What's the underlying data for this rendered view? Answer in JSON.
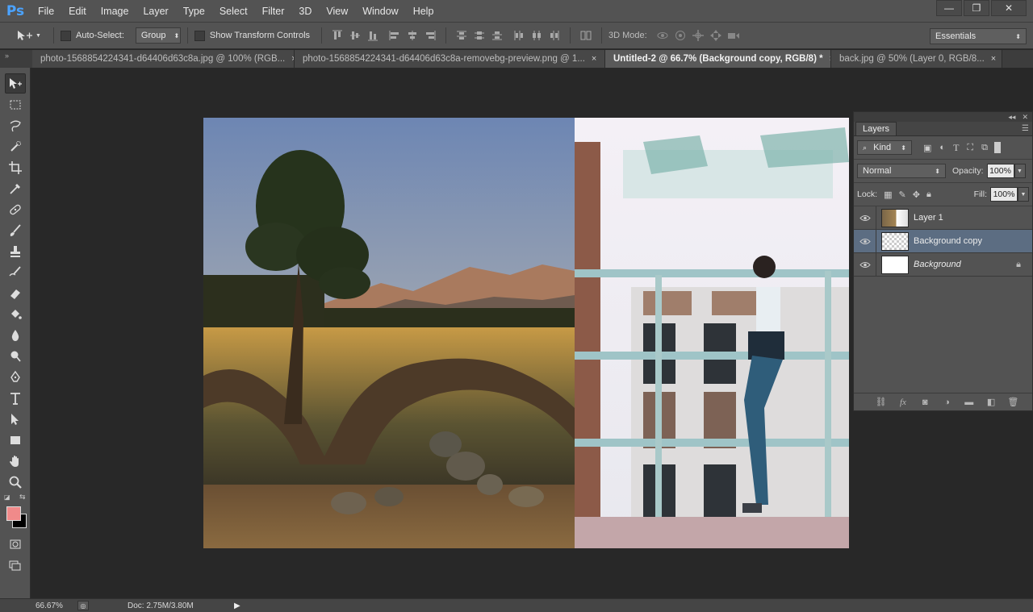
{
  "app": {
    "logo": "Ps"
  },
  "menu": [
    "File",
    "Edit",
    "Image",
    "Layer",
    "Type",
    "Select",
    "Filter",
    "3D",
    "View",
    "Window",
    "Help"
  ],
  "window_controls": {
    "minimize": "—",
    "restore": "❐",
    "close": "✕"
  },
  "options": {
    "auto_select_label": "Auto-Select:",
    "auto_select_value": "Group",
    "show_transform_label": "Show Transform Controls",
    "mode_3d_label": "3D Mode:",
    "workspace_value": "Essentials"
  },
  "tabs": [
    {
      "label": "photo-1568854224341-d64406d63c8a.jpg @ 100% (RGB...",
      "active": false
    },
    {
      "label": "photo-1568854224341-d64406d63c8a-removebg-preview.png @ 1...",
      "active": false
    },
    {
      "label": "Untitled-2 @ 66.7% (Background copy, RGB/8) *",
      "active": true
    },
    {
      "label": "back.jpg @ 50% (Layer 0, RGB/8...",
      "active": false
    }
  ],
  "tab_close": "×",
  "status": {
    "zoom": "66.67%",
    "doc": "Doc: 2.75M/3.80M"
  },
  "layers_panel": {
    "tab_label": "Layers",
    "filter_kind": "Kind",
    "blend_mode": "Normal",
    "opacity_label": "Opacity:",
    "opacity_value": "100%",
    "lock_label": "Lock:",
    "fill_label": "Fill:",
    "fill_value": "100%",
    "layers": [
      {
        "name": "Layer 1",
        "selected": false,
        "locked": false
      },
      {
        "name": "Background copy",
        "selected": true,
        "locked": false
      },
      {
        "name": "Background",
        "selected": false,
        "locked": true
      }
    ]
  },
  "colors": {
    "foreground": "#f08a8a",
    "background": "#000000",
    "selection": "#5c6d82",
    "ps_blue": "#4ba3ff"
  }
}
